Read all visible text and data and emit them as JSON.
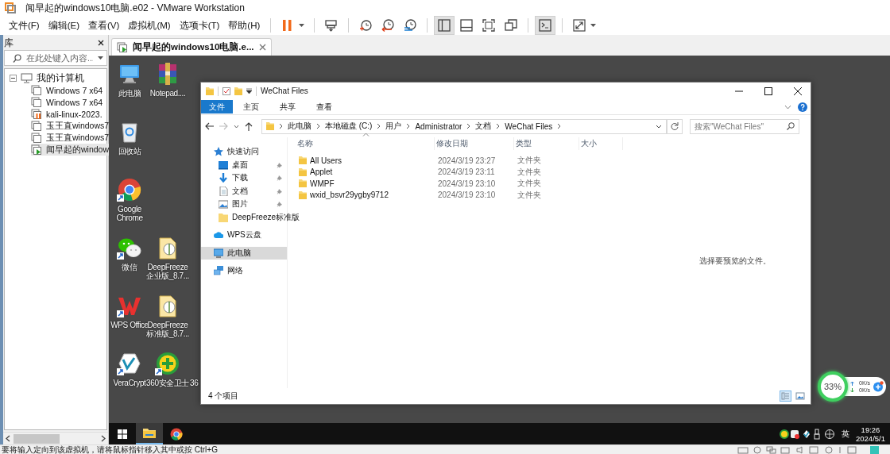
{
  "window": {
    "title": "闻早起的windows10电脑.e02 - VMware Workstation"
  },
  "menu": [
    "文件(F)",
    "编辑(E)",
    "查看(V)",
    "虚拟机(M)",
    "选项卡(T)",
    "帮助(H)"
  ],
  "toolbar": [
    [
      {
        "kind": "pause",
        "pressed": false
      }
    ],
    [
      {
        "kind": "send-keys",
        "pressed": false
      }
    ],
    [
      {
        "kind": "snapshot",
        "pressed": false
      },
      {
        "kind": "revert",
        "pressed": false
      },
      {
        "kind": "snapshot-manager",
        "pressed": false
      }
    ],
    [
      {
        "kind": "library",
        "pressed": true
      },
      {
        "kind": "thumbnail",
        "pressed": false
      },
      {
        "kind": "fullscreen",
        "pressed": false
      },
      {
        "kind": "unity",
        "pressed": false
      }
    ],
    [
      {
        "kind": "console",
        "pressed": true
      }
    ],
    [
      {
        "kind": "stretch",
        "pressed": false
      }
    ]
  ],
  "library": {
    "title": "库",
    "search": {
      "placeholder": "在此处键入内容..."
    },
    "tree": [
      {
        "label": "我的计算机",
        "expanded": true,
        "children": [
          {
            "label": "Windows 7 x64",
            "kind": "off",
            "selected": false
          },
          {
            "label": "Windows 7 x64",
            "kind": "off",
            "selected": false
          },
          {
            "label": "kali-linux-2023.",
            "kind": "paused",
            "selected": false
          },
          {
            "label": "玉王直windows7",
            "kind": "off",
            "selected": false
          },
          {
            "label": "玉王直windows7",
            "kind": "off",
            "selected": false
          },
          {
            "label": "闻早起的window",
            "kind": "running",
            "selected": true
          }
        ]
      }
    ]
  },
  "tabs": [
    {
      "label": "闻早起的windows10电脑.e...",
      "selected": true
    }
  ],
  "desktop": {
    "icons": [
      {
        "label": "此电脑",
        "kind": "pc",
        "shortcut": false
      },
      {
        "label": "回收站",
        "kind": "recycle",
        "shortcut": false
      },
      {
        "label": "Google Chrome",
        "kind": "chrome",
        "shortcut": true
      },
      {
        "label": "微信",
        "kind": "wechat",
        "shortcut": true
      },
      {
        "label": "WPS Office",
        "kind": "wps",
        "shortcut": true
      },
      {
        "label": "VeraCrypt",
        "kind": "veracrypt",
        "shortcut": true
      },
      {
        "label": "Notepad....",
        "kind": "archive",
        "shortcut": false
      },
      {
        "label": "DeepFreeze企业版_8.7...",
        "kind": "package",
        "shortcut": false
      },
      {
        "label": "DeepFreeze标准版_8.7...",
        "kind": "package",
        "shortcut": false
      },
      {
        "label": "360安全卫士",
        "kind": "guard",
        "shortcut": true
      },
      {
        "label": "36"
      }
    ]
  },
  "explorer": {
    "title": "WeChat Files",
    "ribbon_tabs": [
      {
        "label": "文件",
        "selected": true
      },
      {
        "label": "主页",
        "selected": false
      },
      {
        "label": "共享",
        "selected": false
      },
      {
        "label": "查看",
        "selected": false
      }
    ],
    "breadcrumbs": [
      "此电脑",
      "本地磁盘 (C:)",
      "用户",
      "Administrator",
      "文档",
      "WeChat Files"
    ],
    "search": {
      "placeholder": "搜索\"WeChat Files\""
    },
    "nav": [
      {
        "label": "快速访问",
        "kind": "star",
        "selected": false,
        "children": [
          {
            "label": "桌面",
            "kind": "desktop",
            "pinned": true,
            "selected": false
          },
          {
            "label": "下载",
            "kind": "download",
            "pinned": true,
            "selected": false
          },
          {
            "label": "文档",
            "kind": "document",
            "pinned": true,
            "selected": false
          },
          {
            "label": "图片",
            "kind": "picture",
            "pinned": true,
            "selected": false
          },
          {
            "label": "DeepFreeze标准版",
            "kind": "folder",
            "pinned": false,
            "selected": false
          }
        ]
      },
      {
        "label": "WPS云盘",
        "kind": "cloud",
        "selected": false
      },
      {
        "label": "此电脑",
        "kind": "pc",
        "selected": true
      },
      {
        "label": "网络",
        "kind": "network",
        "selected": false
      }
    ],
    "columns": [
      "名称",
      "修改日期",
      "类型",
      "大小"
    ],
    "files": [
      {
        "name": "All Users",
        "modified": "2024/3/19 23:27",
        "type": "文件夹"
      },
      {
        "name": "Applet",
        "modified": "2024/3/19 23:11",
        "type": "文件夹"
      },
      {
        "name": "WMPF",
        "modified": "2024/3/19 23:10",
        "type": "文件夹"
      },
      {
        "name": "wxid_bsvr29ygby9712",
        "modified": "2024/3/19 23:10",
        "type": "文件夹"
      }
    ],
    "preview_text": "选择要预览的文件。",
    "status": "4 个项目",
    "views": [
      {
        "kind": "details",
        "selected": true
      },
      {
        "kind": "large-icons",
        "selected": false
      }
    ]
  },
  "widget": {
    "percent": "33%",
    "upload": "0K/s",
    "download": "0K/s"
  },
  "taskbar": {
    "apps": [
      {
        "kind": "explorer",
        "active": true
      },
      {
        "kind": "chrome",
        "active": false
      }
    ],
    "ime": "英",
    "time": "19:26",
    "date": "2024/5/1"
  },
  "status_bar": "要将输入定向到该虚拟机，请将鼠标指针移入其中或按 Ctrl+G"
}
